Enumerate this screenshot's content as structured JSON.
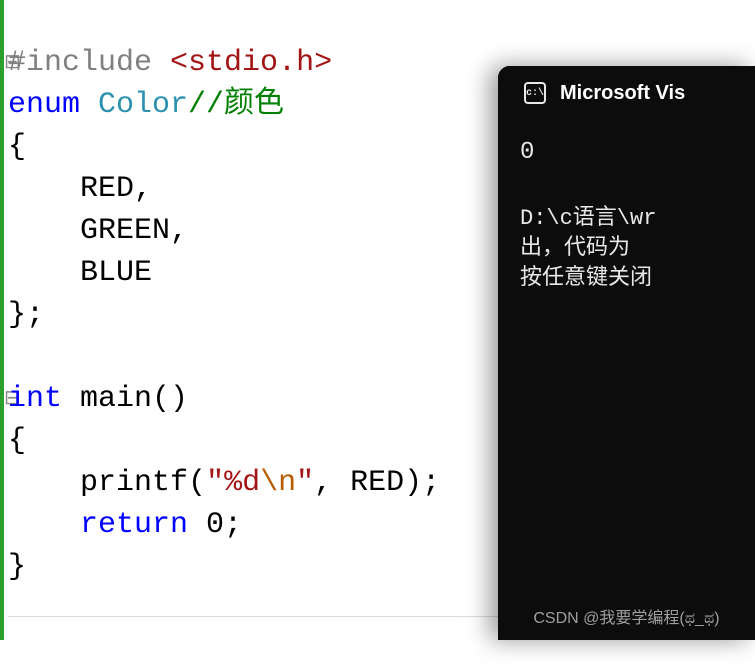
{
  "code": {
    "l1": {
      "preproc": "#include ",
      "angle_open": "<",
      "header": "stdio.h",
      "angle_close": ">"
    },
    "l2": {
      "kw_enum": "enum ",
      "typename": "Color",
      "comment": "//颜色"
    },
    "l3": "{",
    "l4": "    RED,",
    "l5": "    GREEN,",
    "l6": "    BLUE",
    "l7": "};",
    "l8": "",
    "l9": {
      "kw_int": "int ",
      "fn": "main",
      "parens": "()"
    },
    "l10": "{",
    "l11": {
      "indent": "    ",
      "fn": "printf",
      "open": "(",
      "q1": "\"",
      "fmt": "%d",
      "esc": "\\n",
      "q2": "\"",
      "rest": ", RED);"
    },
    "l12": {
      "indent": "    ",
      "kw": "return",
      "rest": " 0;"
    },
    "l13": "}"
  },
  "terminal": {
    "title": "Microsoft Vis",
    "icon_text": "c:\\",
    "output_0": "0",
    "path_line": "D:\\c语言\\wr",
    "exit_line": "出，代码为 ",
    "close_line": "按任意键关闭",
    "watermark": "CSDN @我要学编程(ಥ_ಥ)"
  }
}
